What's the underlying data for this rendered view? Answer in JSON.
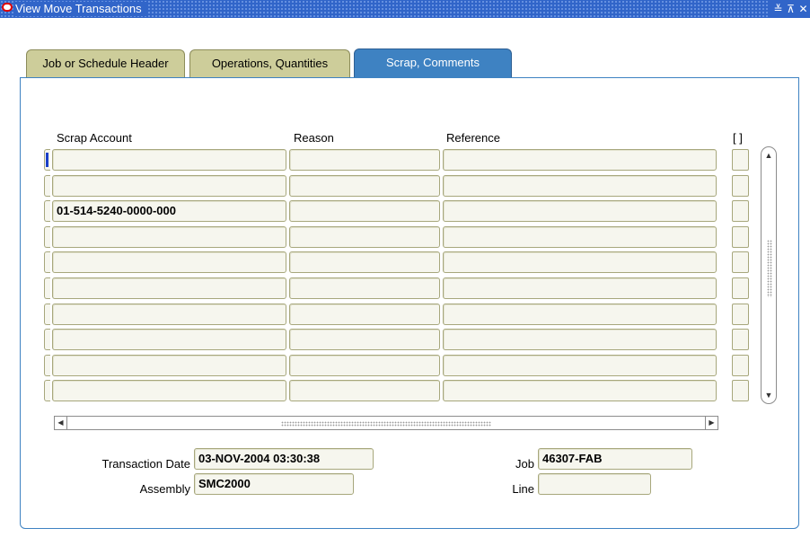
{
  "window": {
    "title": "View Move Transactions",
    "controls": {
      "minimize": "≚",
      "maximize": "⊼",
      "close": "✕"
    }
  },
  "tabs": [
    {
      "label": "Job or Schedule Header",
      "active": false
    },
    {
      "label": "Operations, Quantities",
      "active": false
    },
    {
      "label": "Scrap, Comments",
      "active": true
    }
  ],
  "table": {
    "columns": {
      "scrap_account": "Scrap Account",
      "reason": "Reason",
      "reference": "Reference",
      "flex": "[ ]"
    },
    "rows": [
      {
        "scrap_account": "",
        "reason": "",
        "reference": ""
      },
      {
        "scrap_account": "",
        "reason": "",
        "reference": ""
      },
      {
        "scrap_account": "01-514-5240-0000-000",
        "reason": "",
        "reference": ""
      },
      {
        "scrap_account": "",
        "reason": "",
        "reference": ""
      },
      {
        "scrap_account": "",
        "reason": "",
        "reference": ""
      },
      {
        "scrap_account": "",
        "reason": "",
        "reference": ""
      },
      {
        "scrap_account": "",
        "reason": "",
        "reference": ""
      },
      {
        "scrap_account": "",
        "reason": "",
        "reference": ""
      },
      {
        "scrap_account": "",
        "reason": "",
        "reference": ""
      },
      {
        "scrap_account": "",
        "reason": "",
        "reference": ""
      }
    ],
    "current_row": 0
  },
  "footer": {
    "transaction_date_label": "Transaction Date",
    "transaction_date_value": "03-NOV-2004 03:30:38",
    "assembly_label": "Assembly",
    "assembly_value": "SMC2000",
    "job_label": "Job",
    "job_value": "46307-FAB",
    "line_label": "Line",
    "line_value": ""
  },
  "colors": {
    "titlebar": "#3165c9",
    "active_tab": "#3e82c2",
    "inactive_tab": "#cdcd9a",
    "field_bg": "#f6f6ee",
    "current_record_marker": "#1a3fc8"
  }
}
